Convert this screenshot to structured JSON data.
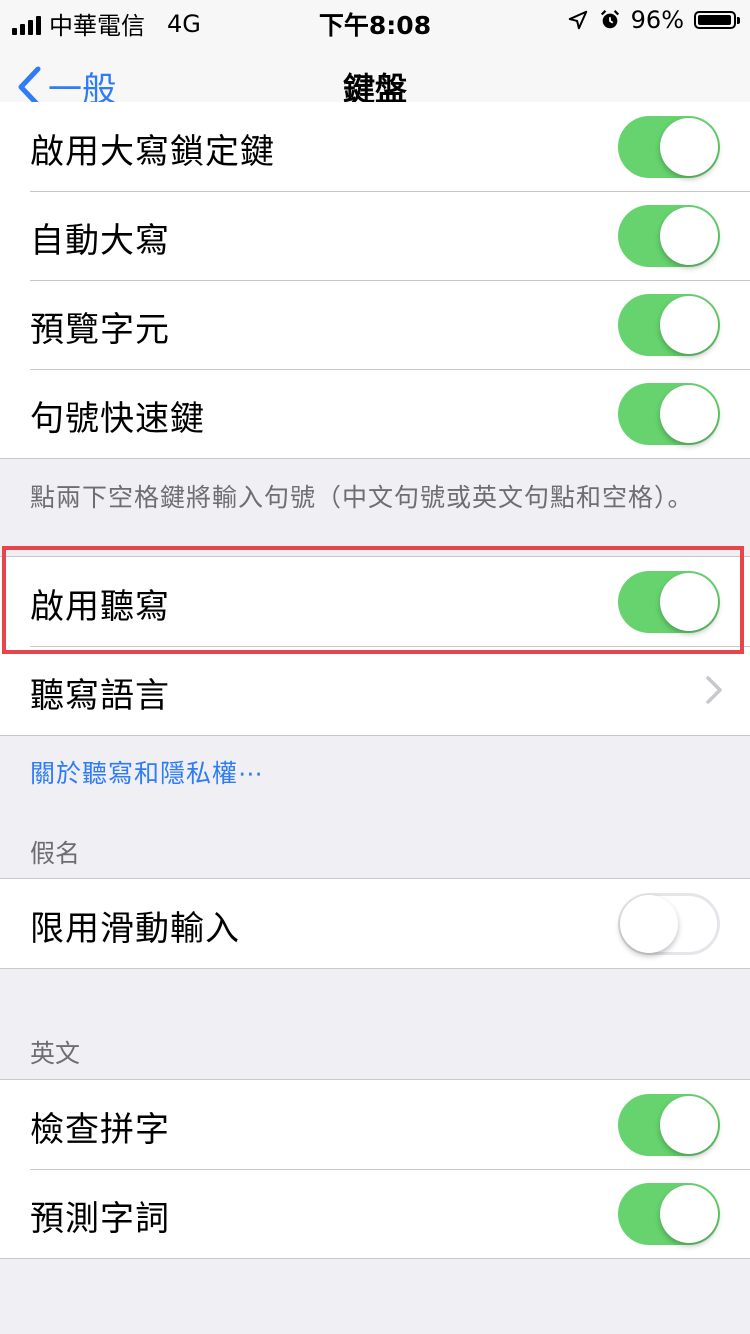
{
  "status_bar": {
    "carrier": "中華電信",
    "network": "4G",
    "time": "下午8:08",
    "battery": "96%",
    "battery_level": 0.96
  },
  "nav": {
    "back_label": "一般",
    "title": "鍵盤"
  },
  "section1": {
    "items": [
      {
        "label": "啟用大寫鎖定鍵",
        "on": true
      },
      {
        "label": "自動大寫",
        "on": true
      },
      {
        "label": "預覽字元",
        "on": true
      },
      {
        "label": "句號快速鍵",
        "on": true
      }
    ],
    "footer": "點兩下空格鍵將輸入句號（中文句號或英文句點和空格）。"
  },
  "section2": {
    "items": [
      {
        "label": "啟用聽寫",
        "on": true
      },
      {
        "label": "聽寫語言"
      }
    ],
    "footer_link": "關於聽寫和隱私權⋯"
  },
  "section3": {
    "header": "假名",
    "items": [
      {
        "label": "限用滑動輸入",
        "on": false
      }
    ]
  },
  "section4": {
    "header": "英文",
    "items": [
      {
        "label": "檢查拼字",
        "on": true
      },
      {
        "label": "預測字詞",
        "on": true
      }
    ]
  },
  "colors": {
    "accent": "#2f7cf6",
    "toggle_on": "#66d36e",
    "highlight": "#e8454b"
  }
}
